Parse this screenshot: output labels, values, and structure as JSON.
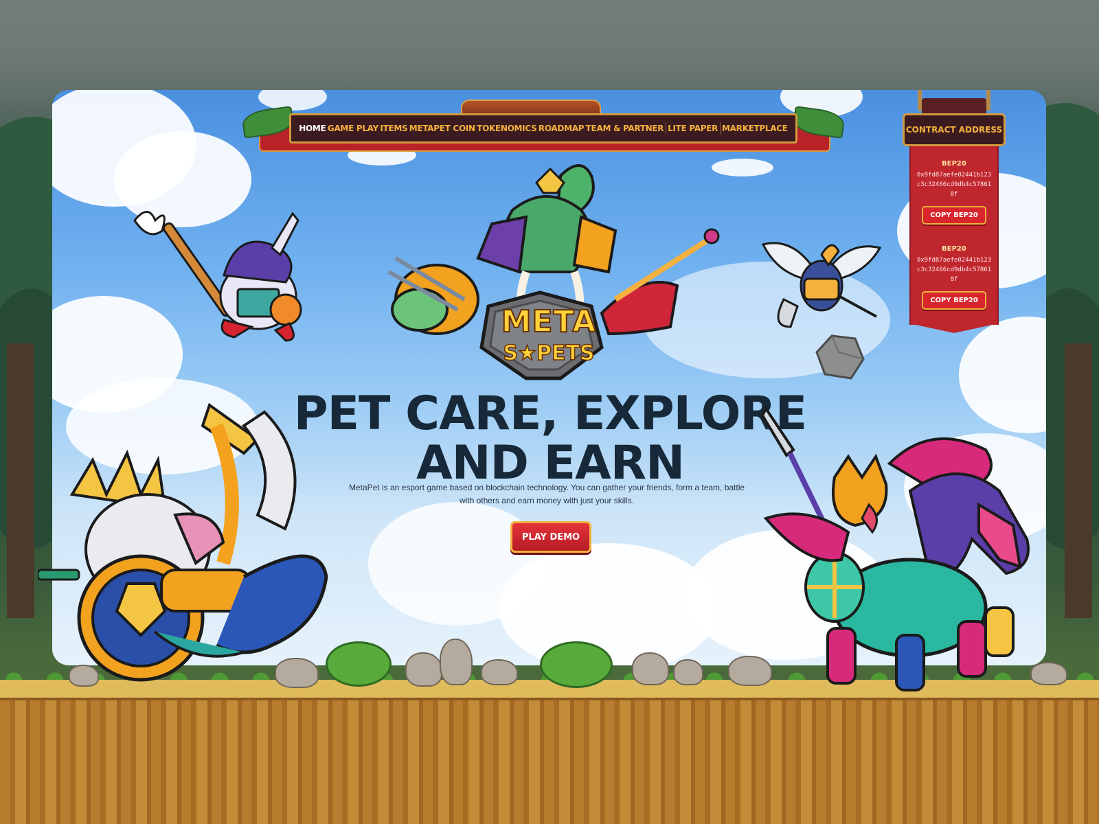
{
  "nav": {
    "items": [
      {
        "label": "HOME",
        "active": true
      },
      {
        "label": "GAME PLAY"
      },
      {
        "label": "ITEMS"
      },
      {
        "label": "METAPET COIN"
      },
      {
        "label": "TOKENOMICS"
      },
      {
        "label": "ROADMAP"
      },
      {
        "label": "TEAM & PARTNER"
      },
      {
        "label": "LITE PAPER"
      },
      {
        "label": "MARKETPLACE"
      }
    ]
  },
  "contract": {
    "header": "CONTRACT ADDRESS",
    "entries": [
      {
        "network": "BEP20",
        "address": "0x9fd87aefe02441b123c3c32466cd9db4c578618f",
        "button": "COPY BEP20"
      },
      {
        "network": "BEP20",
        "address": "0x9fd87aefe02441b123c3c32466cd9db4c578618f",
        "button": "COPY BEP20"
      }
    ]
  },
  "logo": {
    "line1": "META",
    "line2": "S★PETS"
  },
  "hero": {
    "title_line1": "PET CARE, EXPLORE",
    "title_line2": "AND EARN",
    "description": "MetaPet is an esport game based on blockchain technology. You can gather your friends, form a team, battle with others and earn money with just your skills.",
    "cta": "PLAY DEMO"
  },
  "colors": {
    "nav_bg": "#3b1b20",
    "nav_text": "#f4b13e",
    "ribbon_red": "#c0262e",
    "title": "#172838",
    "sky_top": "#4a90e0"
  }
}
